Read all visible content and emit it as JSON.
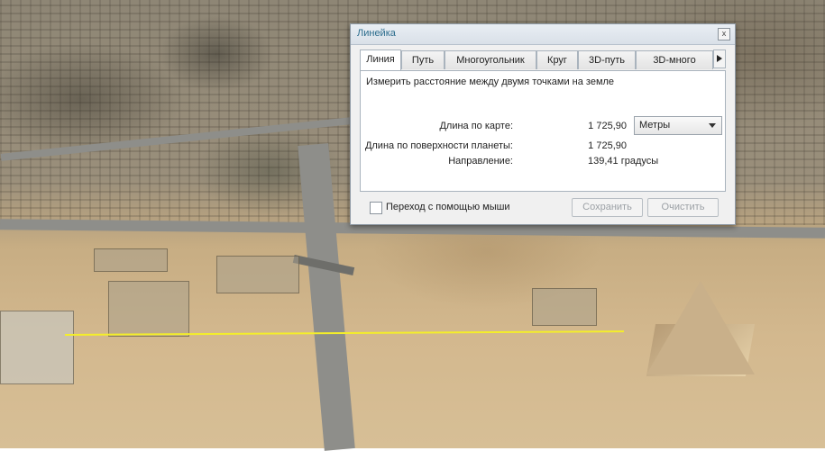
{
  "dialog": {
    "title": "Линейка",
    "close_label": "x",
    "tabs": [
      {
        "label": "Линия",
        "active": true
      },
      {
        "label": "Путь",
        "active": false
      },
      {
        "label": "Многоугольник",
        "active": false
      },
      {
        "label": "Круг",
        "active": false
      },
      {
        "label": "3D-путь",
        "active": false
      },
      {
        "label": "3D-много",
        "active": false
      }
    ],
    "description": "Измерить расстояние между двумя точками на земле",
    "map_length_label": "Длина по карте:",
    "map_length_value": "1 725,90",
    "units_selected": "Метры",
    "surface_length_label": "Длина по поверхности планеты:",
    "surface_length_value": "1 725,90",
    "heading_label": "Направление:",
    "heading_value": "139,41 градусы",
    "mouse_nav_label": "Переход с помощью мыши",
    "mouse_nav_checked": false,
    "save_label": "Сохранить",
    "clear_label": "Очистить"
  },
  "colors": {
    "measure_line": "#f4ee2a",
    "title_text": "#2b6c8d"
  }
}
